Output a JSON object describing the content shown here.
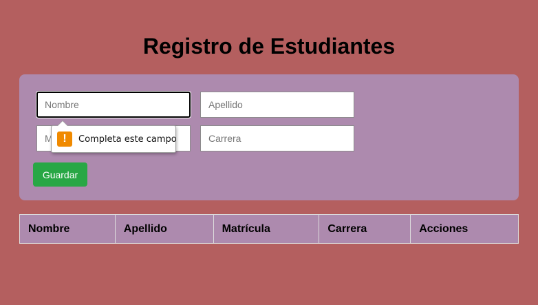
{
  "page": {
    "title": "Registro de Estudiantes"
  },
  "form": {
    "nombre": {
      "placeholder": "Nombre",
      "value": ""
    },
    "apellido": {
      "placeholder": "Apellido",
      "value": ""
    },
    "matricula": {
      "placeholder": "Matrícula",
      "value": ""
    },
    "carrera": {
      "placeholder": "Carrera",
      "value": ""
    },
    "save_label": "Guardar"
  },
  "validation_tooltip": {
    "icon": "warning-icon",
    "icon_glyph": "!",
    "message": "Completa este campo"
  },
  "table": {
    "headers": [
      "Nombre",
      "Apellido",
      "Matrícula",
      "Carrera",
      "Acciones"
    ],
    "rows": []
  },
  "colors": {
    "background": "#b45f5f",
    "panel": "#ad8aae",
    "save_button": "#28a745",
    "warning": "#f08a00"
  }
}
